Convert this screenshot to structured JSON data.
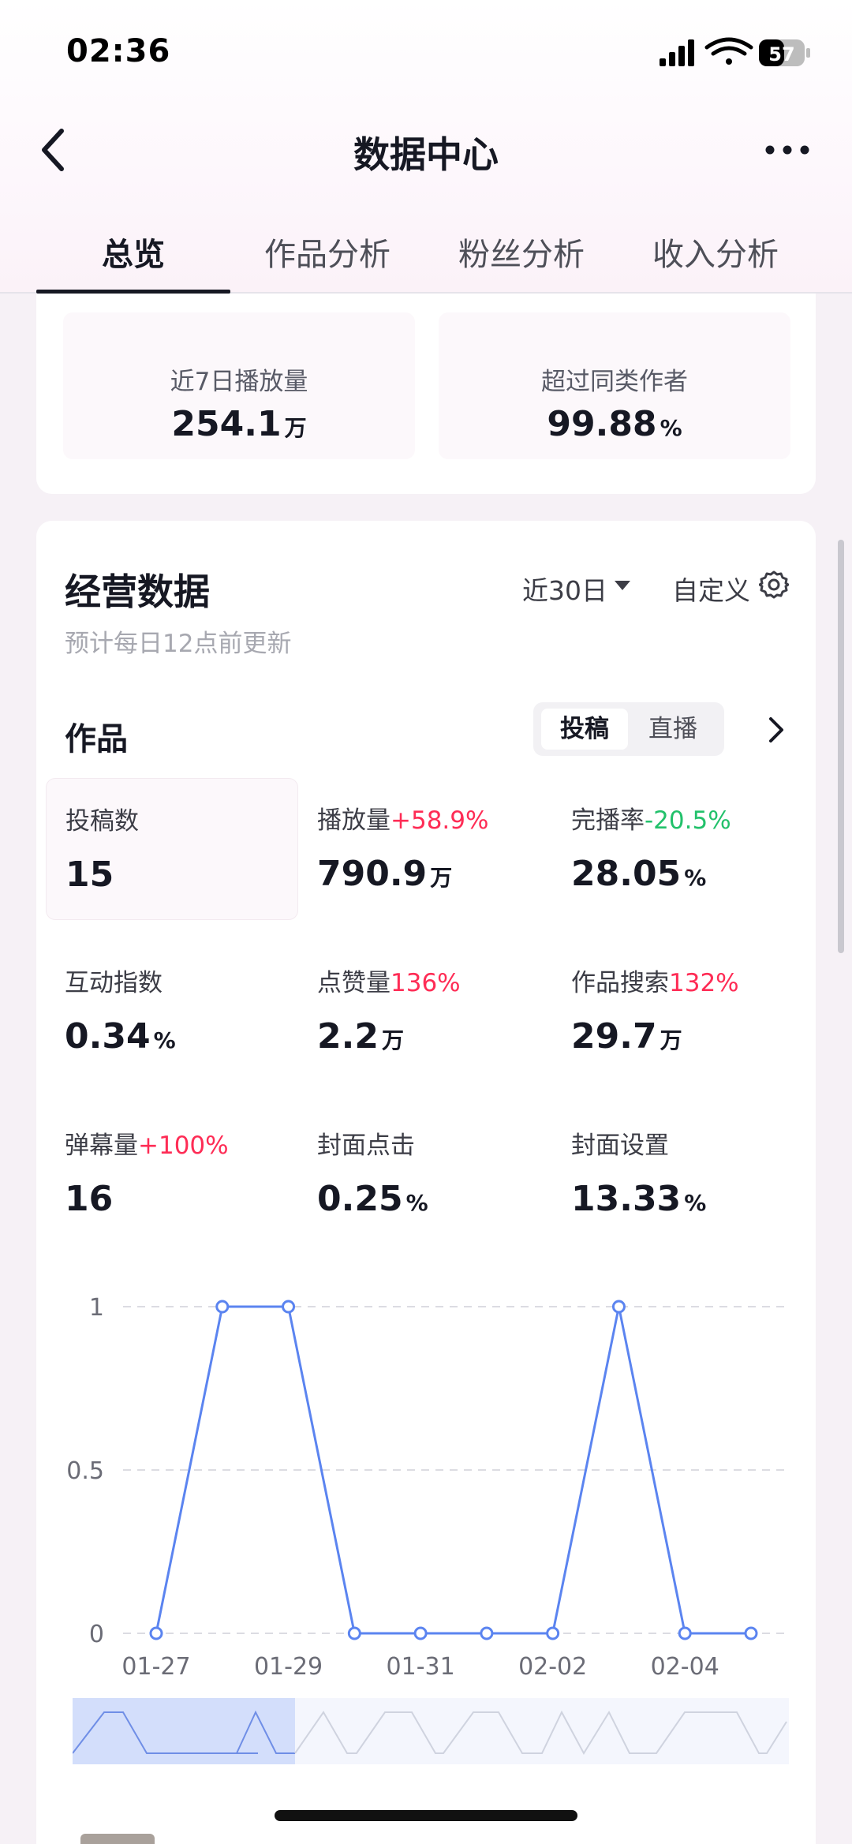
{
  "status_bar": {
    "time": "02:36",
    "battery": "57"
  },
  "nav": {
    "title": "数据中心"
  },
  "tabs": [
    {
      "label": "总览",
      "active": true
    },
    {
      "label": "作品分析",
      "active": false
    },
    {
      "label": "粉丝分析",
      "active": false
    },
    {
      "label": "收入分析",
      "active": false
    }
  ],
  "summary": [
    {
      "label": "近7日播放量",
      "value": "254.1",
      "unit": "万"
    },
    {
      "label": "超过同类作者",
      "value": "99.88",
      "unit": "%"
    }
  ],
  "business": {
    "title": "经营数据",
    "subtitle": "预计每日12点前更新",
    "range": "近30日",
    "custom": "自定义"
  },
  "works": {
    "title": "作品",
    "segments": [
      "投稿",
      "直播"
    ],
    "metrics": [
      {
        "label": "投稿数",
        "change": "",
        "value": "15",
        "unit": ""
      },
      {
        "label": "播放量",
        "change": "+58.9%",
        "value": "790.9",
        "unit": "万"
      },
      {
        "label": "完播率",
        "change": "-20.5%",
        "value": "28.05",
        "unit": "%"
      },
      {
        "label": "互动指数",
        "change": "",
        "value": "0.34",
        "unit": "%"
      },
      {
        "label": "点赞量",
        "change": "136%",
        "value": "2.2",
        "unit": "万"
      },
      {
        "label": "作品搜索",
        "change": "132%",
        "value": "29.7",
        "unit": "万"
      },
      {
        "label": "弹幕量",
        "change": "+100%",
        "value": "16",
        "unit": ""
      },
      {
        "label": "封面点击",
        "change": "",
        "value": "0.25",
        "unit": "%"
      },
      {
        "label": "封面设置",
        "change": "",
        "value": "13.33",
        "unit": "%"
      }
    ]
  },
  "colors": {
    "up": "#fe2c55",
    "down": "#22c16b",
    "line": "#5b84f0"
  },
  "chart_data": {
    "type": "line",
    "x": [
      "01-27",
      "01-28",
      "01-29",
      "01-30",
      "01-31",
      "02-01",
      "02-02",
      "02-03",
      "02-04",
      "02-05"
    ],
    "tick_labels": [
      "01-27",
      "01-29",
      "01-31",
      "02-02",
      "02-04"
    ],
    "y_ticks": [
      "0",
      "0.5",
      "1"
    ],
    "series": [
      {
        "values": [
          0,
          1,
          1,
          0,
          0,
          0,
          0,
          1,
          0,
          0
        ]
      }
    ],
    "ylim": [
      0,
      1
    ],
    "grid": true
  }
}
